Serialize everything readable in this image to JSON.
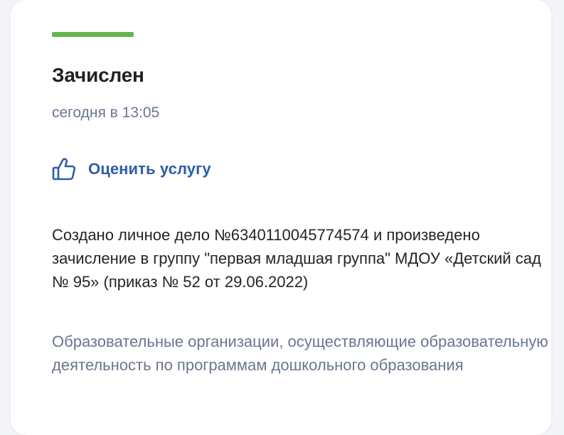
{
  "status": {
    "title": "Зачислен",
    "time": "сегодня в 13:05",
    "stripe_color": "#65b54e"
  },
  "rating": {
    "label": "Оценить услугу",
    "icon": "thumbs-up-icon",
    "color": "#2f5ea7"
  },
  "details": {
    "description": "Создано личное дело №6340110045774574 и произведено зачисление в группу \"первая младшая группа\" МДОУ «Детский сад № 95» (приказ № 52 от 29.06.2022)",
    "organization_type": "Образовательные организации, осуществляющие образовательную деятельность по программам дошкольного образования"
  }
}
